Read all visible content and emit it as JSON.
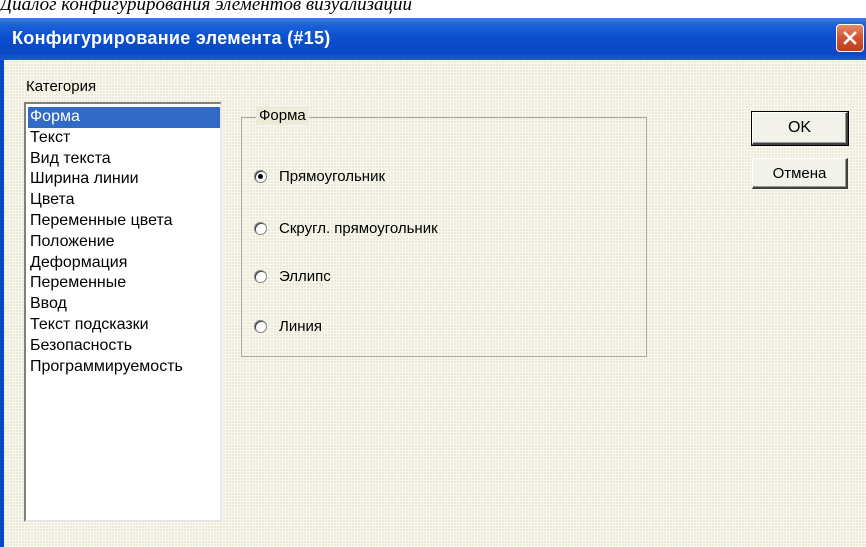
{
  "caption": "Диалог конфигурирования элементов визуализации",
  "dialog": {
    "title": "Конфигурирование элемента (#15)",
    "close_icon": "close-icon"
  },
  "category": {
    "label": "Категория",
    "selected_index": 0,
    "items": [
      "Форма",
      "Текст",
      "Вид текста",
      "Ширина линии",
      "Цвета",
      "Переменные цвета",
      "Положение",
      "Деформация",
      "Переменные",
      "Ввод",
      "Текст подсказки",
      "Безопасность",
      "Программируемость"
    ]
  },
  "shape_group": {
    "legend": "Форма",
    "selected": "Прямоугольник",
    "options": [
      "Прямоугольник",
      "Скругл. прямоугольник",
      "Эллипс",
      "Линия"
    ]
  },
  "buttons": {
    "ok": "OK",
    "cancel": "Отмена"
  },
  "colors": {
    "titlebar": "#0a4ccc",
    "selection": "#316ac5",
    "dialog_background": "#ecead8"
  }
}
